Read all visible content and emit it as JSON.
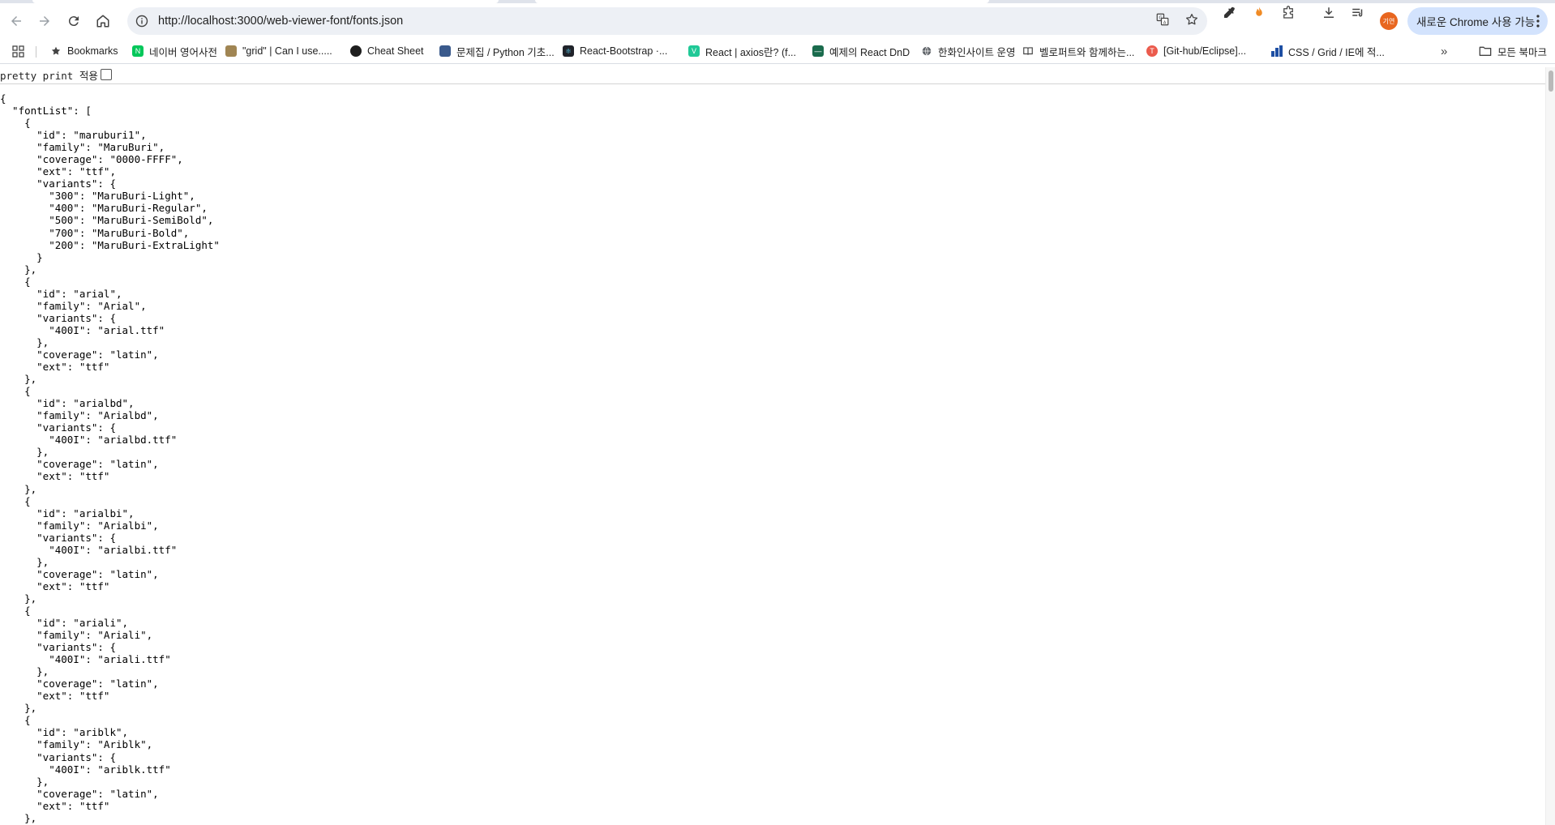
{
  "browser": {
    "url": "http://localhost:3000/web-viewer-font/fonts.json",
    "avatar_label": "기연",
    "update_button": "새로운 Chrome 사용 가능",
    "bookmarks": [
      {
        "label": "Bookmarks",
        "icon": "star-icon",
        "color": "#444444"
      },
      {
        "label": "네이버 영어사전",
        "icon": "naver-dict-icon",
        "color": "#03c75a"
      },
      {
        "label": "\"grid\" | Can I use.....",
        "icon": "caniuse-icon",
        "color": "#8a6d3b"
      },
      {
        "label": "Cheat Sheet",
        "icon": "cheatsheet-icon",
        "color": "#2b2b2b"
      },
      {
        "label": "문제집 / Python 기초...",
        "icon": "problem-icon",
        "color": "#3a5a8c"
      },
      {
        "label": "React-Bootstrap ·...",
        "icon": "react-bootstrap-icon",
        "color": "#20232a"
      },
      {
        "label": "React | axios란? (f...",
        "icon": "velog-icon",
        "color": "#20c997"
      },
      {
        "label": "예제의 React DnD",
        "icon": "dnd-icon",
        "color": "#1a6b4d"
      },
      {
        "label": "한화인사이트 운영",
        "icon": "globe-icon",
        "color": "#555555"
      },
      {
        "label": "벨로퍼트와 함께하는...",
        "icon": "book-icon",
        "color": "#555555"
      },
      {
        "label": "[Git-hub/Eclipse]...",
        "icon": "tistory-icon",
        "color": "#eb5b4d"
      },
      {
        "label": "CSS / Grid / IE에 적...",
        "icon": "css-icon",
        "color": "#1e4fa3"
      }
    ],
    "all_bookmarks": "모든 북마크"
  },
  "page": {
    "pretty_print_label": "pretty print 적용",
    "pretty_print_checked": false,
    "json_text": "{\n  \"fontList\": [\n    {\n      \"id\": \"maruburi1\",\n      \"family\": \"MaruBuri\",\n      \"coverage\": \"0000-FFFF\",\n      \"ext\": \"ttf\",\n      \"variants\": {\n        \"300\": \"MaruBuri-Light\",\n        \"400\": \"MaruBuri-Regular\",\n        \"500\": \"MaruBuri-SemiBold\",\n        \"700\": \"MaruBuri-Bold\",\n        \"200\": \"MaruBuri-ExtraLight\"\n      }\n    },\n    {\n      \"id\": \"arial\",\n      \"family\": \"Arial\",\n      \"variants\": {\n        \"400I\": \"arial.ttf\"\n      },\n      \"coverage\": \"latin\",\n      \"ext\": \"ttf\"\n    },\n    {\n      \"id\": \"arialbd\",\n      \"family\": \"Arialbd\",\n      \"variants\": {\n        \"400I\": \"arialbd.ttf\"\n      },\n      \"coverage\": \"latin\",\n      \"ext\": \"ttf\"\n    },\n    {\n      \"id\": \"arialbi\",\n      \"family\": \"Arialbi\",\n      \"variants\": {\n        \"400I\": \"arialbi.ttf\"\n      },\n      \"coverage\": \"latin\",\n      \"ext\": \"ttf\"\n    },\n    {\n      \"id\": \"ariali\",\n      \"family\": \"Ariali\",\n      \"variants\": {\n        \"400I\": \"ariali.ttf\"\n      },\n      \"coverage\": \"latin\",\n      \"ext\": \"ttf\"\n    },\n    {\n      \"id\": \"ariblk\",\n      \"family\": \"Ariblk\",\n      \"variants\": {\n        \"400I\": \"ariblk.ttf\"\n      },\n      \"coverage\": \"latin\",\n      \"ext\": \"ttf\"\n    },"
  }
}
